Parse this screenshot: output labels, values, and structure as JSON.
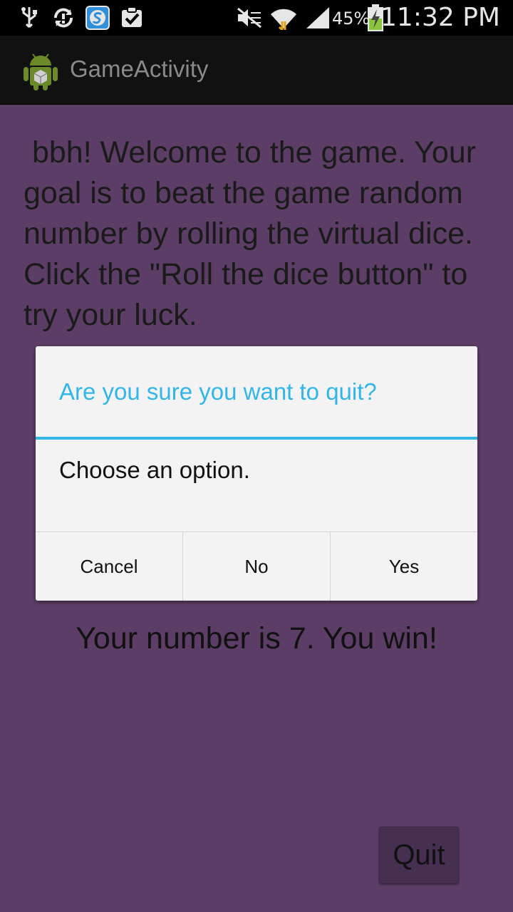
{
  "status_bar": {
    "battery_percent": "45%",
    "time": "11:32 PM",
    "icons": [
      "usb-icon",
      "sync-icon",
      "s-app-icon",
      "clipboard-check-icon",
      "mute-icon",
      "wifi-icon",
      "signal-icon",
      "battery-charging-icon"
    ]
  },
  "action_bar": {
    "title": "GameActivity",
    "icon": "android-icon"
  },
  "main": {
    "welcome": " bbh! Welcome to the game. Your goal is to beat the game random number by rolling the virtual dice. Click the \"Roll the dice button\" to try your luck.",
    "result": "Your number is 7. You win!",
    "quit_label": "Quit"
  },
  "dialog": {
    "title": "Are you sure you want to quit?",
    "message": "Choose an option.",
    "buttons": {
      "cancel": "Cancel",
      "no": "No",
      "yes": "Yes"
    }
  },
  "colors": {
    "background": "#5c3d66",
    "accent": "#33b5e5",
    "action_bar": "#111111"
  }
}
